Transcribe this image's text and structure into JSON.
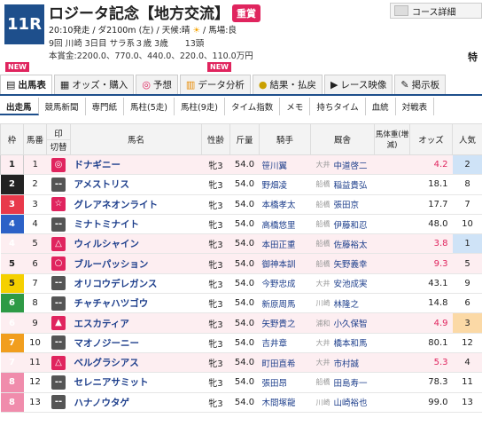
{
  "race": {
    "number": "11R",
    "title": "ロジータ記念【地方交流】",
    "grade": "重賞",
    "course_detail": "コース詳細",
    "info_line1_a": "20:10発走 / ダ2100m (左) / 天候:晴",
    "info_line1_b": "/ 馬場:良",
    "info_line2": "9回 川崎 3日目 サラ系３歳 3歳　　13頭",
    "prize": "本賞金:2200.0、770.0、440.0、220.0、110.0万円",
    "toku": "特"
  },
  "new_badges": [
    "NEW",
    "NEW"
  ],
  "tabs": [
    {
      "label": "出馬表",
      "icon": "table-icon"
    },
    {
      "label": "オッズ・購入",
      "icon": "odds-icon"
    },
    {
      "label": "予想",
      "icon": "target-icon"
    },
    {
      "label": "データ分析",
      "icon": "chart-icon"
    },
    {
      "label": "結果・払戻",
      "icon": "coin-icon"
    },
    {
      "label": "レース映像",
      "icon": "video-icon"
    },
    {
      "label": "掲示板",
      "icon": "board-icon"
    }
  ],
  "subtabs": [
    "出走馬",
    "競馬新聞",
    "専門紙",
    "馬柱(5走)",
    "馬柱(9走)",
    "タイム指数",
    "メモ",
    "持ちタイム",
    "血統",
    "対戦表"
  ],
  "columns": {
    "waku": "枠",
    "num": "馬番",
    "mark_top": "印",
    "mark_bottom": "切替",
    "name": "馬名",
    "sex": "性齢",
    "weight": "斤量",
    "jockey": "騎手",
    "trainer": "厩舎",
    "body": "馬体重(増減)",
    "odds": "オッズ",
    "pop": "人気"
  },
  "horses": [
    {
      "waku": "1",
      "num": "1",
      "mark": "◎",
      "name": "ドナギニー",
      "sex": "牝3",
      "weight": "54.0",
      "jockey": "笹川翼",
      "region": "大井",
      "trainer": "中道啓二",
      "odds": "4.2",
      "pop": "2",
      "hot": true
    },
    {
      "waku": "2",
      "num": "2",
      "mark": "--",
      "name": "アメストリス",
      "sex": "牝3",
      "weight": "54.0",
      "jockey": "野畑凌",
      "region": "船橋",
      "trainer": "稲益貴弘",
      "odds": "18.1",
      "pop": "8",
      "hot": false
    },
    {
      "waku": "3",
      "num": "3",
      "mark": "☆",
      "name": "グレアネオンライト",
      "sex": "牝3",
      "weight": "54.0",
      "jockey": "本橋孝太",
      "region": "船橋",
      "trainer": "張田京",
      "odds": "17.7",
      "pop": "7",
      "hot": false
    },
    {
      "waku": "4",
      "num": "4",
      "mark": "--",
      "name": "ミナトミナイト",
      "sex": "牝3",
      "weight": "54.0",
      "jockey": "高橋悠里",
      "region": "船橋",
      "trainer": "伊藤和忍",
      "odds": "48.0",
      "pop": "10",
      "hot": false
    },
    {
      "waku": "4",
      "num": "5",
      "mark": "△",
      "name": "ウィルシャイン",
      "sex": "牝3",
      "weight": "54.0",
      "jockey": "本田正重",
      "region": "船橋",
      "trainer": "佐藤裕太",
      "odds": "3.8",
      "pop": "1",
      "hot": true
    },
    {
      "waku": "5",
      "num": "6",
      "mark": "○",
      "name": "ブルーパッション",
      "sex": "牝3",
      "weight": "54.0",
      "jockey": "御神本訓",
      "region": "船橋",
      "trainer": "矢野義幸",
      "odds": "9.3",
      "pop": "5",
      "hot": true
    },
    {
      "waku": "5",
      "num": "7",
      "mark": "--",
      "name": "オリコウデレガンス",
      "sex": "牝3",
      "weight": "54.0",
      "jockey": "今野忠成",
      "region": "大井",
      "trainer": "安池成実",
      "odds": "43.1",
      "pop": "9",
      "hot": false
    },
    {
      "waku": "6",
      "num": "8",
      "mark": "--",
      "name": "チャチャハツゴウ",
      "sex": "牝3",
      "weight": "54.0",
      "jockey": "新原周馬",
      "region": "川崎",
      "trainer": "林隆之",
      "odds": "14.8",
      "pop": "6",
      "hot": false
    },
    {
      "waku": "6",
      "num": "9",
      "mark": "▲",
      "name": "エスカティア",
      "sex": "牝3",
      "weight": "54.0",
      "jockey": "矢野貴之",
      "region": "浦和",
      "trainer": "小久保智",
      "odds": "4.9",
      "pop": "3",
      "hot": true
    },
    {
      "waku": "7",
      "num": "10",
      "mark": "--",
      "name": "マオノジーニー",
      "sex": "牝3",
      "weight": "54.0",
      "jockey": "吉井章",
      "region": "大井",
      "trainer": "橋本和馬",
      "odds": "80.1",
      "pop": "12",
      "hot": false
    },
    {
      "waku": "7",
      "num": "11",
      "mark": "△",
      "name": "ベルグラシアス",
      "sex": "牝3",
      "weight": "54.0",
      "jockey": "町田直希",
      "region": "大井",
      "trainer": "市村誠",
      "odds": "5.3",
      "pop": "4",
      "hot": true
    },
    {
      "waku": "8",
      "num": "12",
      "mark": "--",
      "name": "セレニアサミット",
      "sex": "牝3",
      "weight": "54.0",
      "jockey": "張田昂",
      "region": "船橋",
      "trainer": "田島寿一",
      "odds": "78.3",
      "pop": "11",
      "hot": false
    },
    {
      "waku": "8",
      "num": "13",
      "mark": "--",
      "name": "ハナノウタゲ",
      "sex": "牝3",
      "weight": "54.0",
      "jockey": "木間塚龍",
      "region": "川崎",
      "trainer": "山崎裕也",
      "odds": "99.0",
      "pop": "13",
      "hot": false
    }
  ],
  "colors": {
    "accent": "#1e4f8c",
    "hot": "#e0245e"
  }
}
